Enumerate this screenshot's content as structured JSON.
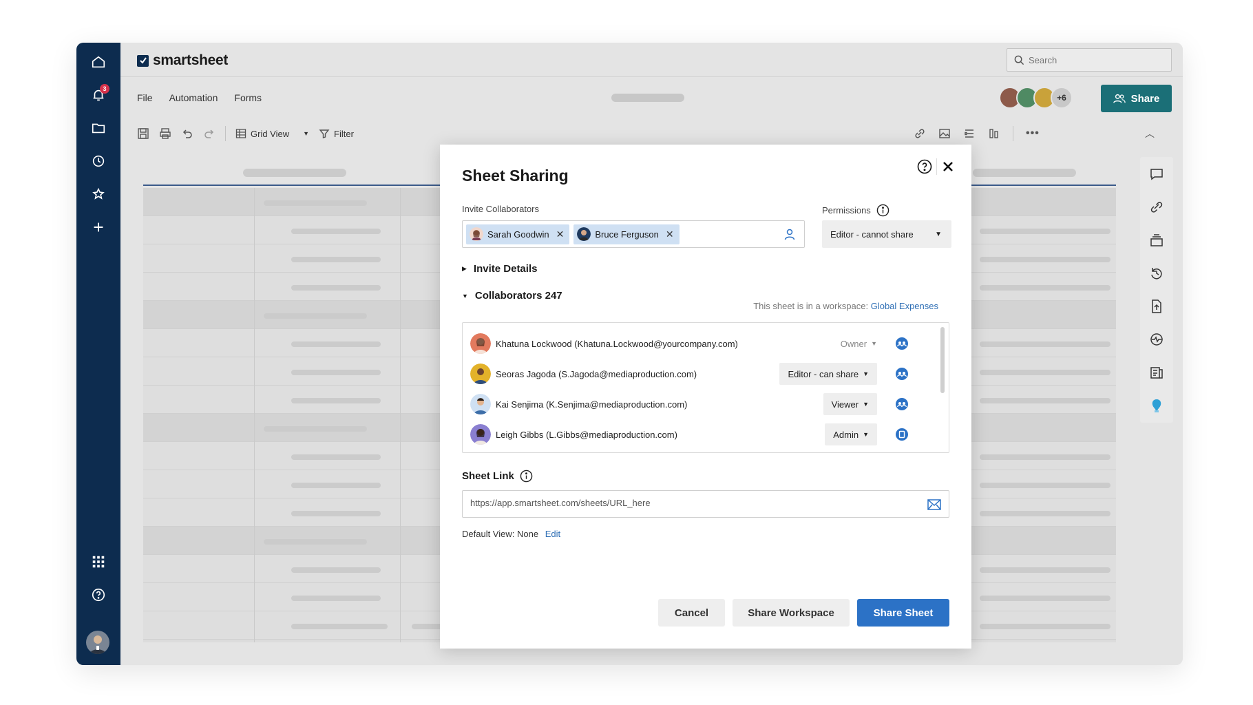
{
  "app": {
    "logo_text": "smartsheet",
    "notification_count": "3",
    "search_placeholder": "Search",
    "menu": [
      "File",
      "Automation",
      "Forms"
    ],
    "share_label": "Share",
    "avatars_more": "+6",
    "toolbar": {
      "grid_view_label": "Grid View",
      "filter_label": "Filter"
    }
  },
  "modal": {
    "title": "Sheet Sharing",
    "invite_label": "Invite Collaborators",
    "invitees": [
      {
        "name": "Sarah Goodwin"
      },
      {
        "name": "Bruce Ferguson"
      }
    ],
    "permissions_label": "Permissions",
    "permission_value": "Editor - cannot share",
    "invite_details_label": "Invite Details",
    "collaborators_label": "Collaborators 247",
    "workspace_note": "This sheet is in a workspace:",
    "workspace_link": "Global Expenses",
    "collaborators": [
      {
        "name": "Khatuna Lockwood (Khatuna.Lockwood@yourcompany.com)",
        "role": "Owner"
      },
      {
        "name": "Seoras Jagoda (S.Jagoda@mediaproduction.com)",
        "role": "Editor - can share"
      },
      {
        "name": "Kai Senjima (K.Senjima@mediaproduction.com)",
        "role": "Viewer"
      },
      {
        "name": "Leigh Gibbs (L.Gibbs@mediaproduction.com)",
        "role": "Admin"
      }
    ],
    "sheet_link_label": "Sheet Link",
    "sheet_link_value": "https://app.smartsheet.com/sheets/URL_here",
    "default_view_label": "Default View:",
    "default_view_value": "None",
    "default_view_edit": "Edit",
    "buttons": {
      "cancel": "Cancel",
      "share_workspace": "Share Workspace",
      "share_sheet": "Share Sheet"
    }
  },
  "colors": {
    "nav_bg": "#0d2c4f",
    "share_button": "#1b6f77",
    "primary_button": "#2c72c6",
    "chip_bg": "#cfe0f3",
    "link": "#2f6fb5"
  }
}
